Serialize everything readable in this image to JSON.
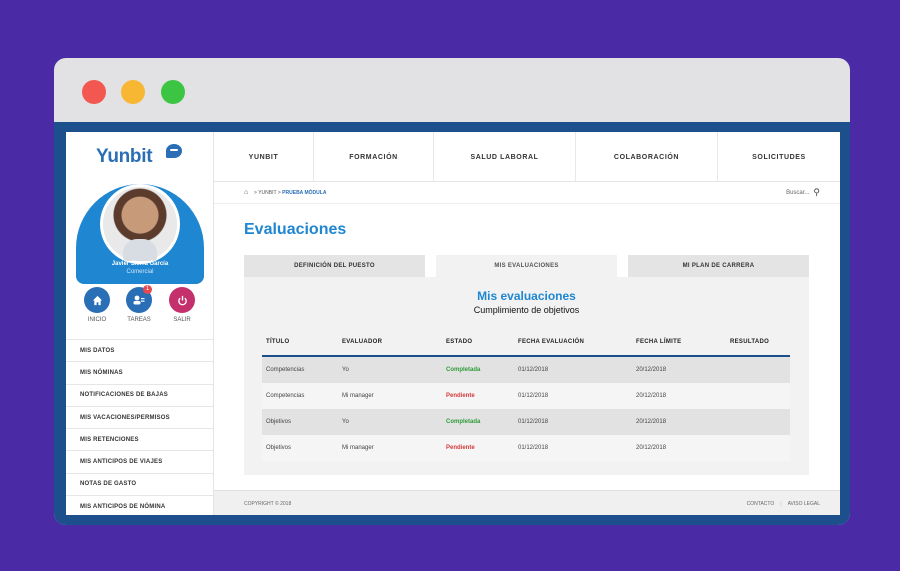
{
  "window": {
    "controls": [
      "close",
      "minimize",
      "maximize"
    ]
  },
  "brand": {
    "logo": "Yunbit"
  },
  "user": {
    "name": "Javier Sierra García",
    "role": "Comercial"
  },
  "quick_actions": [
    {
      "label": "INICIO",
      "icon": "home-icon"
    },
    {
      "label": "TAREAS",
      "icon": "tasks-icon",
      "badge": "1"
    },
    {
      "label": "SALIR",
      "icon": "power-icon"
    }
  ],
  "sidebar_menu": [
    "MIS DATOS",
    "MIS NÓMINAS",
    "NOTIFICACIONES DE BAJAS",
    "MIS VACACIONES/PERMISOS",
    "MIS RETENCIONES",
    "MIS ANTICIPOS DE VIAJES",
    "NOTAS DE GASTO",
    "MIS ANTICIPOS DE NÓMINA"
  ],
  "topnav": [
    "YUNBIT",
    "FORMACIÓN",
    "SALUD LABORAL",
    "COLABORACIÓN",
    "SOLICITUDES"
  ],
  "breadcrumb": {
    "path": "> YUNBIT > ",
    "current": "PRUEBA MÓDULA"
  },
  "search": {
    "placeholder": "Buscar..."
  },
  "page": {
    "title": "Evaluaciones"
  },
  "tabs": [
    {
      "label": "DEFINICIÓN DEL PUESTO",
      "active": false
    },
    {
      "label": "MIS EVALUACIONES",
      "active": true
    },
    {
      "label": "MI PLAN DE CARRERA",
      "active": false
    }
  ],
  "panel": {
    "title": "Mis evaluaciones",
    "subtitle": "Cumplimiento de objetivos"
  },
  "table": {
    "headers": [
      "TÍTULO",
      "EVALUADOR",
      "ESTADO",
      "FECHA EVALUACIÓN",
      "FECHA LÍMITE",
      "RESULTADO"
    ],
    "rows": [
      [
        "Competencias",
        "Yo",
        "Completada",
        "01/12/2018",
        "20/12/2018",
        ""
      ],
      [
        "Competencias",
        "Mi manager",
        "Pendiente",
        "01/12/2018",
        "20/12/2018",
        ""
      ],
      [
        "Objetivos",
        "Yo",
        "Completada",
        "01/12/2018",
        "20/12/2018",
        ""
      ],
      [
        "Objetivos",
        "Mi manager",
        "Pendiente",
        "01/12/2018",
        "20/12/2018",
        ""
      ]
    ]
  },
  "footer": {
    "copyright": "COPYRIGHT © 2018",
    "links": [
      "CONTACTO",
      "AVISO LEGAL"
    ]
  },
  "colors": {
    "accent": "#1f86d1",
    "completed": "#2e9c3a",
    "pending": "#d33b3b",
    "background": "#4b2aa6"
  }
}
